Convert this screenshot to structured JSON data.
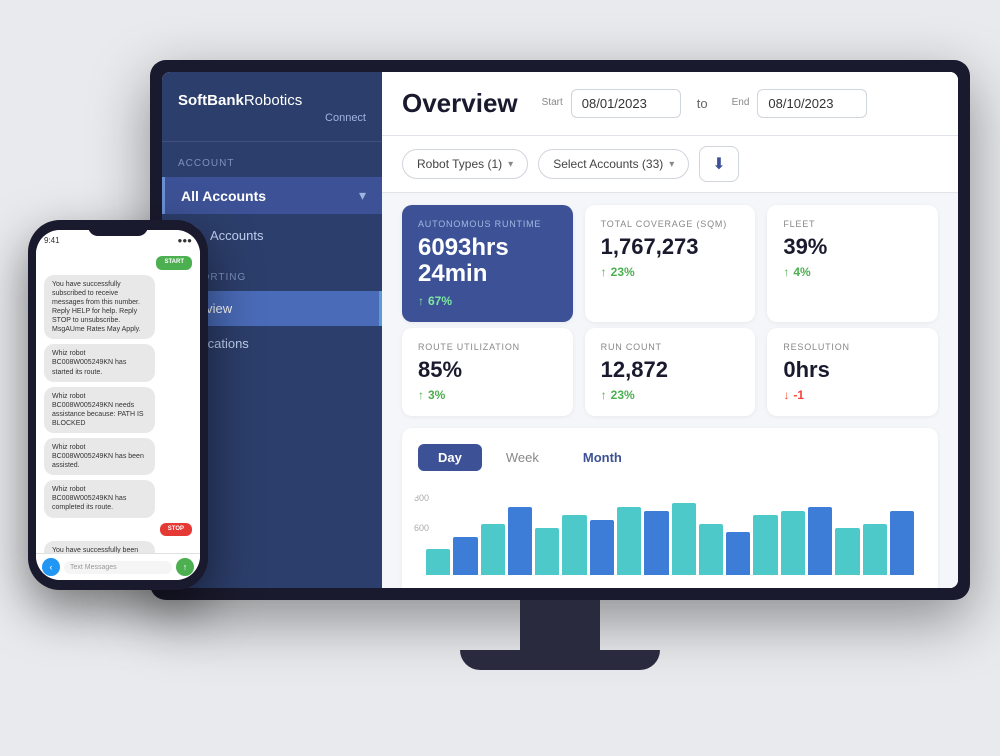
{
  "app": {
    "title": "SoftBank Robotics Connect",
    "logo_bold": "SoftBank",
    "logo_light": "Robotics",
    "logo_connect": "Connect"
  },
  "sidebar": {
    "account_label": "ACCOUNT",
    "all_accounts": "All Accounts",
    "accounts_item": "Accounts",
    "reporting_label": "REPORTING",
    "overview_item": "verview",
    "notifications_item": "otifications"
  },
  "header": {
    "title": "Overview",
    "start_label": "Start",
    "start_date": "08/01/2023",
    "to_text": "to",
    "end_label": "End",
    "end_date": "08/10/2023"
  },
  "filters": {
    "robot_types": "Robot Types (1)",
    "select_accounts": "Select Accounts (33)",
    "download_icon": "⬇"
  },
  "stats": {
    "autonomous_runtime": {
      "label": "AUTONOMOUS RUNTIME",
      "value": "6093hrs 24min",
      "trend": "67%",
      "trend_direction": "up"
    },
    "total_coverage": {
      "label": "TOTAL COVERAGE (SQM)",
      "value": "1,767,273",
      "trend": "23%",
      "trend_direction": "up"
    },
    "fleet": {
      "label": "FLEET",
      "value": "39%",
      "trend": "4%",
      "trend_direction": "up"
    },
    "route_utilization": {
      "label": "ROUTE UTILIZATION",
      "value": "85%",
      "trend": "3%",
      "trend_direction": "up"
    },
    "run_count": {
      "label": "RUN COUNT",
      "value": "12,872",
      "trend": "23%",
      "trend_direction": "up"
    },
    "resolution": {
      "label": "RESOLUTION",
      "value": "0hrs",
      "trend": "-1",
      "trend_direction": "down"
    }
  },
  "chart": {
    "tabs": [
      "Day",
      "Week",
      "Month"
    ],
    "active_tab": "Day",
    "y_labels": [
      "800",
      "600"
    ],
    "bars": [
      30,
      45,
      60,
      80,
      55,
      70,
      65,
      80,
      75,
      85,
      60,
      50,
      70,
      75,
      80,
      55,
      60,
      75
    ]
  },
  "phone": {
    "time": "9:41",
    "status_icons": "●●●",
    "messages": [
      {
        "type": "sent",
        "style": "start",
        "text": "START"
      },
      {
        "type": "received",
        "text": "You have successfully subscribed to receive messages from this number. Reply HELP for help. Reply STOP to unsubscribe. MsgAUme Rates May Apply."
      },
      {
        "type": "received",
        "text": "Whiz robot BC008W005249KN has started its route."
      },
      {
        "type": "received",
        "text": "Whiz robot BC008W005249KN needs assistance because: PATH IS BLOCKED"
      },
      {
        "type": "received",
        "text": "Whiz robot BC008W005249KN has been assisted."
      },
      {
        "type": "received",
        "text": "Whiz robot BC008W005249KN has completed its route."
      },
      {
        "type": "sent",
        "style": "stop",
        "text": "STOP"
      },
      {
        "type": "received",
        "text": "You have successfully been unsubscribed. You will not receive any more messages from this number. Reply START to resubscribe."
      }
    ],
    "input_placeholder": "Text Messages"
  }
}
